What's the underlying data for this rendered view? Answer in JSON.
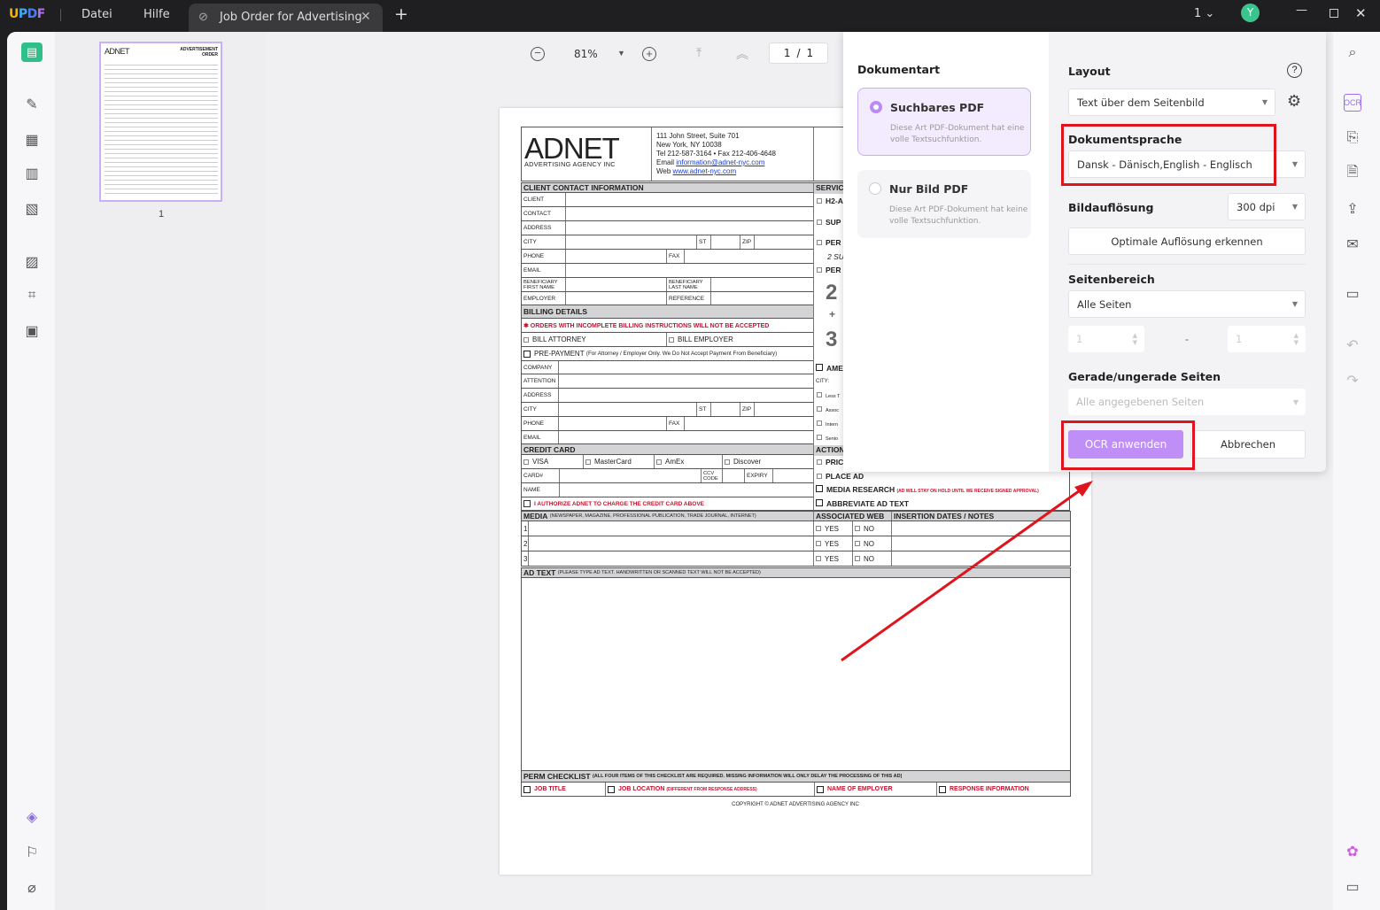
{
  "titlebar": {
    "logo": "UPDF",
    "menu": [
      "Datei",
      "Hilfe"
    ],
    "tab_title": "Job Order for Advertising",
    "new_tab": "+",
    "page_count": "1",
    "avatar": "Y"
  },
  "toolbar": {
    "zoom": "81%",
    "page_current": "1",
    "page_sep": "/",
    "page_total": "1"
  },
  "thumbnail": {
    "page_number": "1",
    "title": "ADVERTISEMENT ORDER"
  },
  "document": {
    "address": [
      "111 John Street, Suite 701",
      "New York, NY 10038",
      "Tel 212-587-3164 • Fax 212-406-4648"
    ],
    "email_label": "Email",
    "email": "information@adnet-nyc.com",
    "web_label": "Web",
    "web": "www.adnet-nyc.com",
    "logo_big": "ADNET",
    "logo_small": "ADVERTISING AGENCY INC",
    "client_header": "CLIENT CONTACT INFORMATION",
    "labels": {
      "client": "CLIENT",
      "contact": "CONTACT",
      "address": "ADDRESS",
      "city": "CITY",
      "st": "ST",
      "zip": "ZIP",
      "phone": "PHONE",
      "fax": "FAX",
      "email": "EMAIL",
      "ben_first": "BENEFICIARY FIRST NAME",
      "ben_last": "BENEFICIARY LAST NAME",
      "employer": "EMPLOYER",
      "reference": "REFERENCE",
      "company": "COMPANY",
      "attention": "ATTENTION",
      "card": "CARD#",
      "ccv": "CCV CODE",
      "expiry": "EXPIRY",
      "name": "NAME"
    },
    "billing_header": "BILLING DETAILS",
    "billing_warning": "✱ ORDERS WITH INCOMPLETE BILLING INSTRUCTIONS WILL NOT BE ACCEPTED",
    "bill_attorney": "BILL ATTORNEY",
    "bill_employer": "BILL EMPLOYER",
    "prepayment": "PRE-PAYMENT",
    "prepayment_note": "(For Attorney / Employer Only. We Do Not Accept Payment From Beneficiary)",
    "credit_header": "CREDIT CARD",
    "cards": [
      "VISA",
      "MasterCard",
      "AmEx",
      "Discover"
    ],
    "authorize": "I AUTHORIZE ADNET TO CHARGE THE CREDIT CARD ABOVE",
    "media_header": "MEDIA",
    "media_note": "(NEWSPAPER, MAGAZINE, PROFESSIONAL PUBLICATION, TRADE JOURNAL, INTERNET)",
    "assoc_web": "ASSOCIATED WEB",
    "insertion": "INSERTION DATES / NOTES",
    "media_rows": [
      "1",
      "2",
      "3"
    ],
    "yes": "YES",
    "no": "NO",
    "adtext_header": "AD TEXT",
    "adtext_note": "(PLEASE TYPE AD TEXT. HANDWRITTEN OR SCANNED TEXT WILL NOT BE ACCEPTED)",
    "perm_header": "PERM CHECKLIST",
    "perm_note": "(ALL FOUR ITEMS OF THIS CHECKLIST ARE REQUIRED. MISSING INFORMATION WILL ONLY DELAY THE PROCESSING OF THIS AD)",
    "perm_items": [
      "JOB TITLE",
      "JOB LOCATION",
      "NAME OF EMPLOYER",
      "RESPONSE INFORMATION"
    ],
    "perm_loc_note": "(DIFFERENT FROM RESPONSE ADDRESS)",
    "copyright": "COPYRIGHT © ADNET ADVERTISING AGENCY INC",
    "right_col": {
      "service": "SERVIC",
      "h2a": "H2-A",
      "sup": "SUP",
      "per1": "PER",
      "su2": "2 SU",
      "per2": "PER",
      "two": "2",
      "plus": "+",
      "three": "3",
      "ame": "AME",
      "city": "CITY:",
      "less": "Less T",
      "assoc": "Assoc",
      "intern": "Intern",
      "senior": "Senio",
      "action": "ACTION",
      "price": "PRIC",
      "place_ad": "PLACE AD",
      "media_research": "MEDIA RESEARCH",
      "media_research_note": "(AD WILL STAY ON HOLD UNTIL WE RECEIVE SIGNED APPROVAL)",
      "abbreviate": "ABBREVIATE AD TEXT"
    }
  },
  "ocr_panel": {
    "doc_type_label": "Dokumentart",
    "options": [
      {
        "title": "Suchbares PDF",
        "desc": "Diese Art PDF-Dokument hat eine volle Textsuchfunktion.",
        "selected": true
      },
      {
        "title": "Nur Bild PDF",
        "desc": "Diese Art PDF-Dokument hat keine volle Textsuchfunktion.",
        "selected": false
      }
    ],
    "layout_label": "Layout",
    "layout_value": "Text über dem Seitenbild",
    "lang_label": "Dokumentsprache",
    "lang_value": "Dansk - Dänisch,English - Englisch",
    "res_label": "Bildauflösung",
    "res_value": "300 dpi",
    "detect_button": "Optimale Auflösung erkennen",
    "range_label": "Seitenbereich",
    "range_value": "Alle Seiten",
    "range_from": "1",
    "range_dash": "-",
    "range_to": "1",
    "parity_label": "Gerade/ungerade Seiten",
    "parity_value": "Alle angegebenen Seiten",
    "apply_button": "OCR anwenden",
    "cancel_button": "Abbrechen"
  },
  "colors": {
    "accent": "#b98cf5",
    "highlight": "#e0141c",
    "logo_u": "#f5b400"
  }
}
